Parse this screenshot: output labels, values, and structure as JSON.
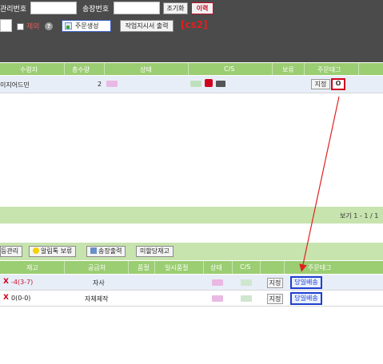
{
  "toolbar": {
    "mgmt_no_label": "관리번호",
    "invoice_no_label": "송장번호",
    "reset_button": "조기화",
    "history_button": "이력",
    "exclude_label": "제외",
    "help_icon": "?",
    "create_order_button": "주문생성",
    "print_work_button": "작업지시서 출력",
    "annotation": "[cs2]"
  },
  "upper_grid": {
    "columns": [
      "수령자",
      "총수량",
      "상태",
      "C/S",
      "보류",
      "주문태그"
    ],
    "rows": [
      {
        "recipient": "이지어드민",
        "qty": "2",
        "tag_assign": "지정",
        "tag_value": "O"
      }
    ],
    "page_info": "보기 1 - 1 / 1"
  },
  "lower_toolbar": {
    "buttons": [
      "등관리",
      "알림톡 보류",
      "송장출력",
      "미할당재고"
    ]
  },
  "lower_grid": {
    "columns": [
      "재고",
      "공급처",
      "품절",
      "일시품절",
      "상태",
      "C/S",
      "",
      "주문태그"
    ],
    "rows": [
      {
        "stock": "-4(3-7)",
        "supplier": "자사",
        "tag_assign": "지정",
        "tag_value": "당일배송",
        "stock_color": "#c8102e"
      },
      {
        "stock": "0(0-0)",
        "supplier": "자체제작",
        "tag_assign": "지정",
        "tag_value": "당일배송",
        "stock_color": "#222222"
      }
    ]
  },
  "colors": {
    "header_green": "#9bcd72",
    "toolbar_dark": "#4b4b4b",
    "highlight_red": "#d0021b",
    "tag_blue": "#1e3fd0"
  }
}
